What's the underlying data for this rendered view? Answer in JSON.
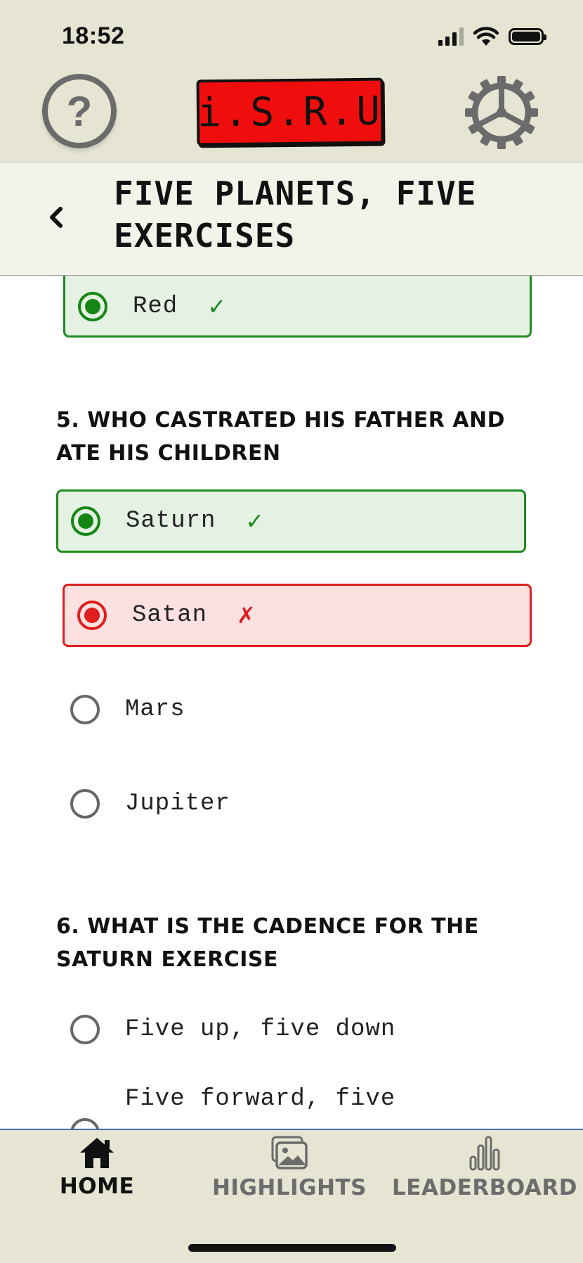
{
  "status_bar": {
    "time": "18:52"
  },
  "header": {
    "help_symbol": "?",
    "logo_text": "i.S.R.U",
    "title": "FIVE PLANETS, FIVE EXERCISES"
  },
  "quiz": {
    "prev_answer": {
      "label": "Red",
      "mark": "✓"
    },
    "q5": {
      "text": "5. WHO CASTRATED HIS FATHER AND ATE HIS CHILDREN",
      "options": [
        {
          "label": "Saturn",
          "mark": "✓",
          "state": "correct"
        },
        {
          "label": "Satan",
          "mark": "✗",
          "state": "wrong"
        },
        {
          "label": "Mars",
          "mark": "",
          "state": "unselected"
        },
        {
          "label": "Jupiter",
          "mark": "",
          "state": "unselected"
        }
      ]
    },
    "q6": {
      "text": "6. WHAT IS THE CADENCE FOR THE SATURN EXERCISE",
      "options": [
        {
          "label": "Five up, five down",
          "state": "unselected"
        },
        {
          "label": "Five forward, five",
          "state": "unselected"
        }
      ]
    }
  },
  "bottom_nav": {
    "items": [
      {
        "label": "HOME",
        "icon": "home-icon",
        "active": true
      },
      {
        "label": "HIGHLIGHTS",
        "icon": "image-icon",
        "active": false
      },
      {
        "label": "LEADERBOARD",
        "icon": "bar-chart-icon",
        "active": false
      }
    ]
  },
  "colors": {
    "header_bg": "#e6e4d2",
    "correct": "#1f8a1f",
    "wrong": "#e01e1e",
    "logo_red": "#f00d0d"
  }
}
